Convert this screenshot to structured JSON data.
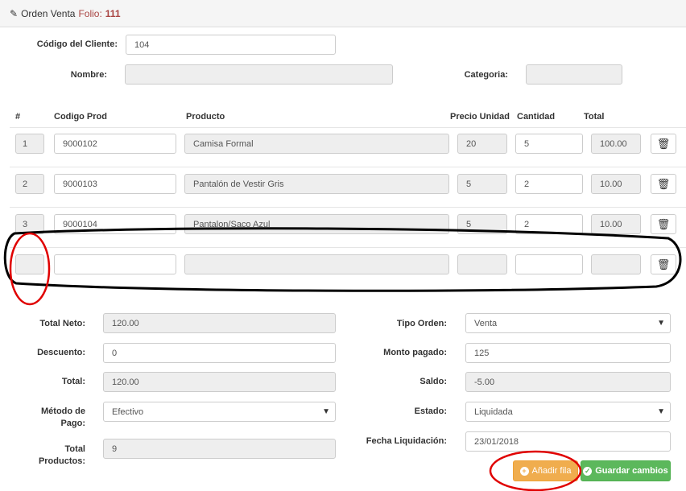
{
  "header": {
    "pencil_glyph": "✎",
    "title": "Orden Venta",
    "folio_label": "Folio:",
    "folio_value": "111"
  },
  "cliente": {
    "codigo_label": "Código del Cliente:",
    "codigo_value": "104",
    "nombre_label": "Nombre:",
    "nombre_value": "",
    "categoria_label": "Categoria:",
    "categoria_value": ""
  },
  "table": {
    "headers": {
      "num": "#",
      "codigo": "Codigo Prod",
      "producto": "Producto",
      "precio": "Precio Unidad",
      "cantidad": "Cantidad",
      "total": "Total"
    },
    "rows": [
      {
        "num": "1",
        "codigo": "9000102",
        "producto": "Camisa Formal",
        "precio": "20",
        "cantidad": "5",
        "total": "100.00"
      },
      {
        "num": "2",
        "codigo": "9000103",
        "producto": "Pantalón de Vestir Gris",
        "precio": "5",
        "cantidad": "2",
        "total": "10.00"
      },
      {
        "num": "3",
        "codigo": "9000104",
        "producto": "Pantalon/Saco Azul",
        "precio": "5",
        "cantidad": "2",
        "total": "10.00"
      },
      {
        "num": "",
        "codigo": "",
        "producto": "",
        "precio": "",
        "cantidad": "",
        "total": ""
      }
    ],
    "delete_glyph": "🗑"
  },
  "summary": {
    "total_neto_label": "Total Neto:",
    "total_neto_value": "120.00",
    "descuento_label": "Descuento:",
    "descuento_value": "0",
    "total_label": "Total:",
    "total_value": "120.00",
    "metodo_label_1": "Método de",
    "metodo_label_2": "Pago:",
    "metodo_value": "Efectivo",
    "total_productos_label_1": "Total",
    "total_productos_label_2": "Productos:",
    "total_productos_value": "9",
    "tipo_orden_label": "Tipo Orden:",
    "tipo_orden_value": "Venta",
    "monto_label": "Monto pagado:",
    "monto_value": "125",
    "saldo_label": "Saldo:",
    "saldo_value": "-5.00",
    "estado_label": "Estado:",
    "estado_value": "Liquidada",
    "fecha_label": "Fecha Liquidación:",
    "fecha_value": "23/01/2018",
    "caret_glyph": "▼"
  },
  "buttons": {
    "add_icon": "+",
    "add_label": "Añadir fila",
    "save_icon": "✓",
    "save_label": "Guardar cambios"
  },
  "colors": {
    "folio": "#a94442",
    "btn_orange": "#f0ad4e",
    "btn_green": "#5cb85c",
    "annotation_black": "#000000",
    "annotation_red": "#e00000"
  }
}
